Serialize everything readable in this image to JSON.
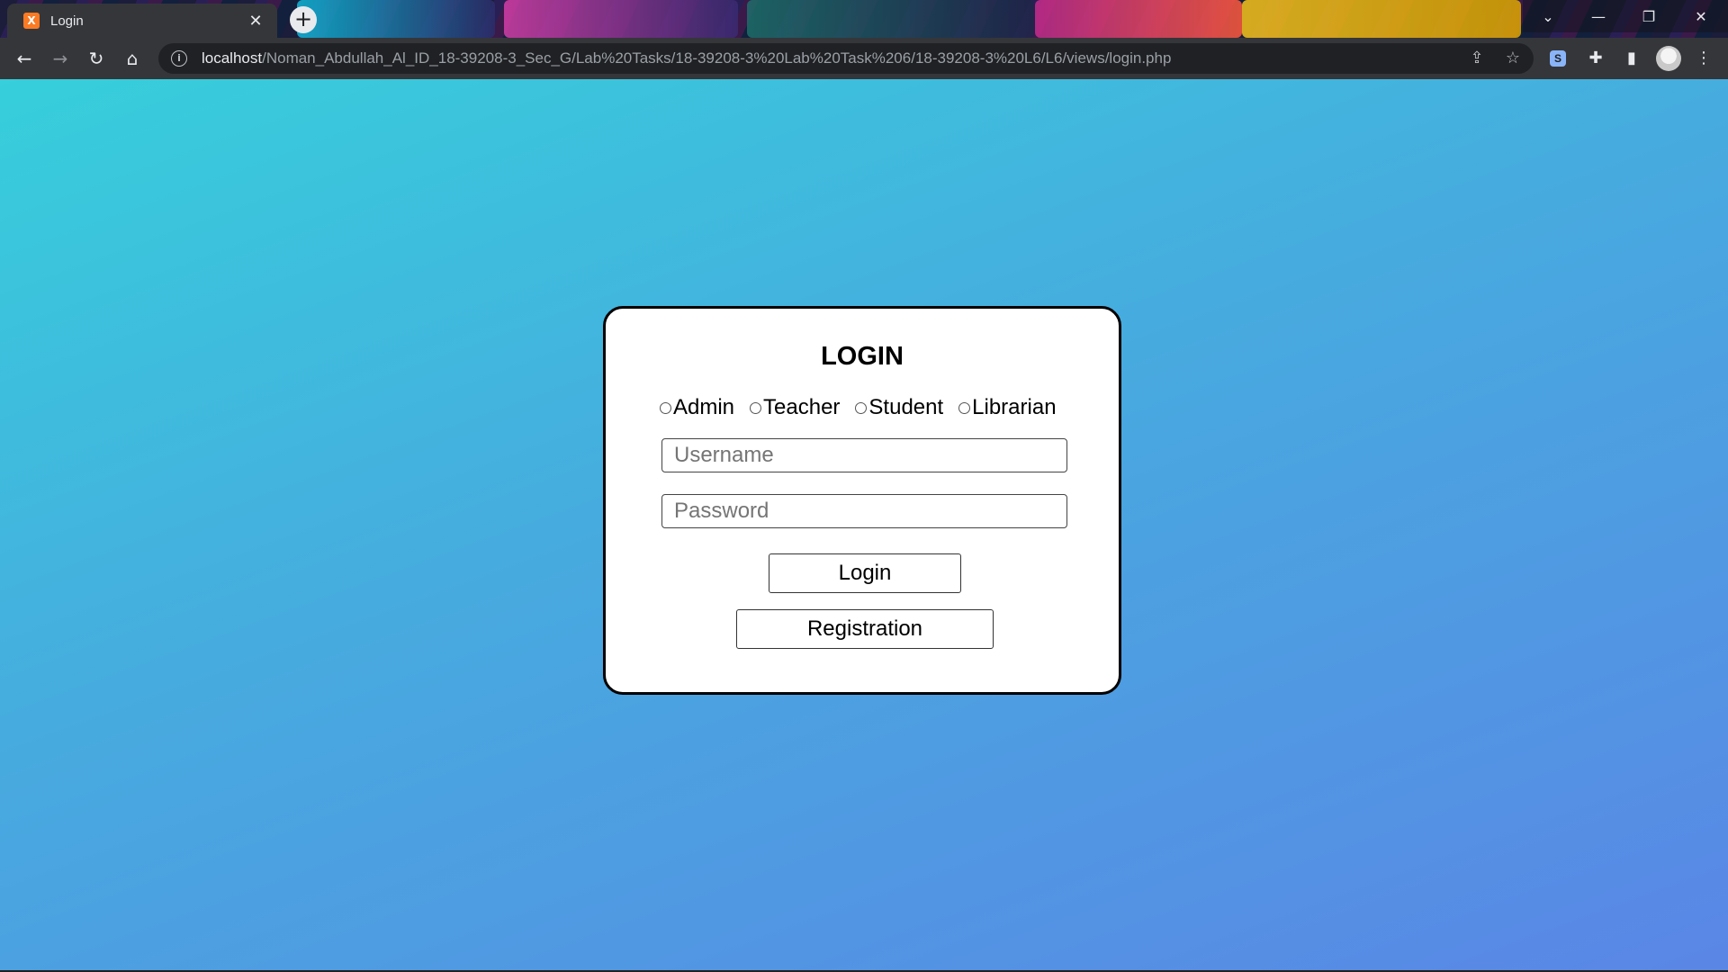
{
  "browser": {
    "tab": {
      "favicon_text": "X",
      "title": "Login",
      "close": "✕"
    },
    "new_tab": "+",
    "window_controls": {
      "dropdown": "⌄",
      "minimize": "—",
      "restore": "❐",
      "close": "✕"
    },
    "nav": {
      "back": "←",
      "forward": "→",
      "reload": "↻",
      "home": "⌂"
    },
    "address": {
      "info": "i",
      "host": "localhost",
      "path": "/Noman_Abdullah_Al_ID_18-39208-3_Sec_G/Lab%20Tasks/18-39208-3%20Lab%20Task%206/18-39208-3%20L6/L6/views/login.php"
    },
    "omnibox_icons": {
      "share": "⇪",
      "bookmark": "☆"
    },
    "extensions": {
      "s_ext": "S",
      "puzzle": "✚",
      "sidepanel": "▮",
      "menu": "⋮"
    }
  },
  "login": {
    "title": "LOGIN",
    "roles": [
      "Admin",
      "Teacher",
      "Student",
      "Librarian"
    ],
    "username_placeholder": "Username",
    "password_placeholder": "Password",
    "login_button": "Login",
    "registration_button": "Registration"
  },
  "colors": {
    "background_start": "#36cfdb",
    "background_end": "#5a86e6",
    "card": "#ffffff",
    "chrome_toolbar": "#35363a"
  }
}
